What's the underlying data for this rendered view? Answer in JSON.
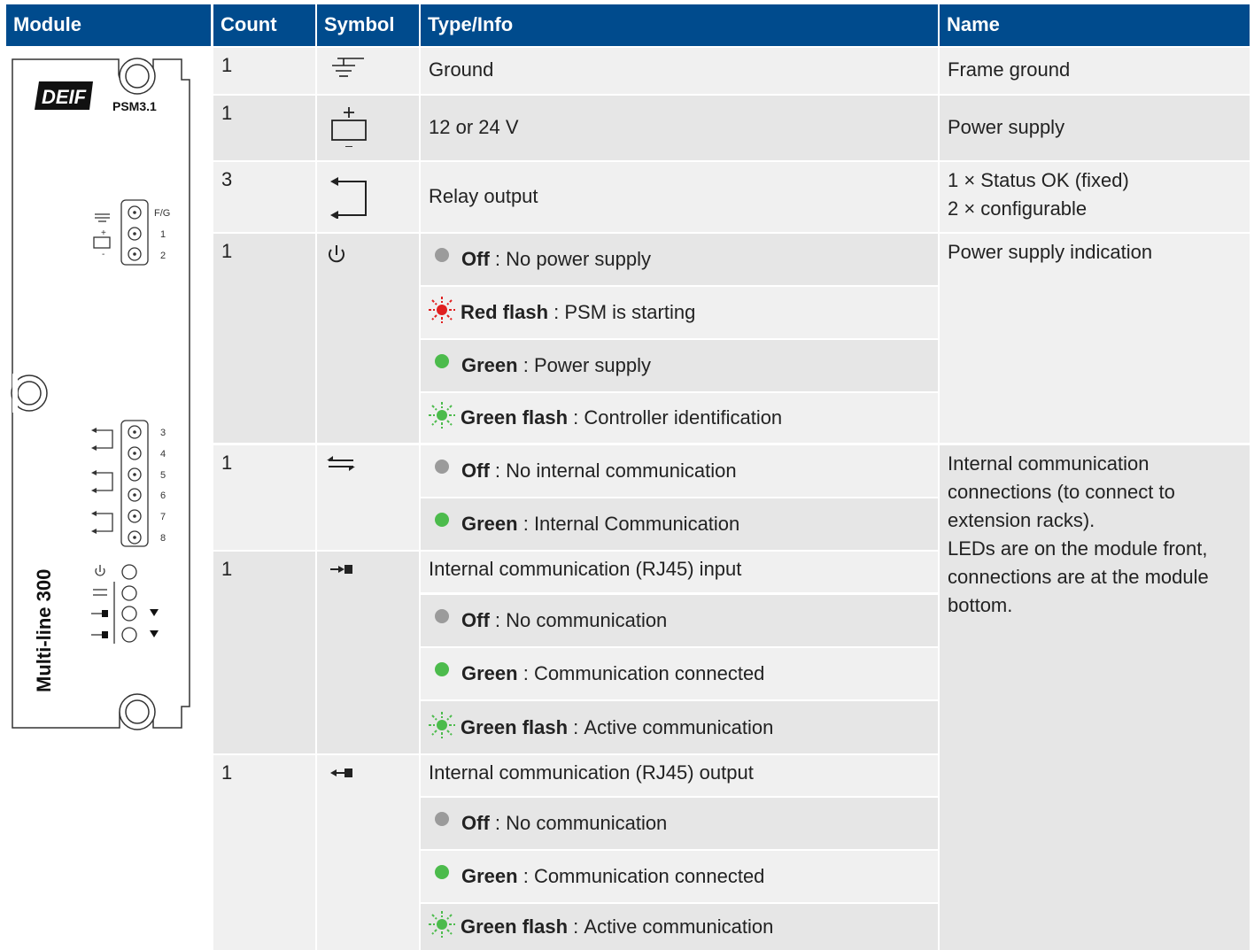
{
  "headers": {
    "module": "Module",
    "count": "Count",
    "symbol": "Symbol",
    "type_info": "Type/Info",
    "name": "Name"
  },
  "module_panel": {
    "brand": "DEIF",
    "model": "PSM3.1",
    "product": "Multi-line 300",
    "terminal_labels": [
      "F/G",
      "1",
      "2",
      "3",
      "4",
      "5",
      "6",
      "7",
      "8"
    ]
  },
  "rows": [
    {
      "count": "1",
      "symbol_icon": "ground-icon",
      "type": "Ground",
      "name": "Frame ground"
    },
    {
      "count": "1",
      "symbol_icon": "battery-icon",
      "type": "12 or 24 V",
      "name": "Power supply"
    },
    {
      "count": "3",
      "symbol_icon": "relay-icon",
      "type": "Relay output",
      "name_lines": [
        "1 × Status OK (fixed)",
        "2 × configurable"
      ]
    },
    {
      "count": "1",
      "symbol_icon": "power-icon",
      "name": "Power supply indication",
      "leds": [
        {
          "state": "Off",
          "desc": "No power supply",
          "indicator": "gray"
        },
        {
          "state": "Red flash",
          "desc": "PSM is starting",
          "indicator": "red-flash"
        },
        {
          "state": "Green",
          "desc": "Power supply",
          "indicator": "green"
        },
        {
          "state": "Green flash",
          "desc": "Controller identification",
          "indicator": "green-flash"
        }
      ]
    },
    {
      "count": "1",
      "symbol_icon": "internal-comm-icon",
      "name_lines": [
        "Internal communication",
        "connections (to connect to",
        "extension racks).",
        "LEDs are on the module front,",
        "connections are at the module",
        "bottom."
      ],
      "leds": [
        {
          "state": "Off",
          "desc": "No internal communication",
          "indicator": "gray"
        },
        {
          "state": "Green",
          "desc": "Internal Communication",
          "indicator": "green"
        }
      ]
    },
    {
      "count": "1",
      "symbol_icon": "rj45-input-icon",
      "type": "Internal communication (RJ45) input",
      "leds": [
        {
          "state": "Off",
          "desc": "No communication",
          "indicator": "gray"
        },
        {
          "state": "Green",
          "desc": "Communication connected",
          "indicator": "green"
        },
        {
          "state": "Green flash",
          "desc": "Active communication",
          "indicator": "green-flash"
        }
      ]
    },
    {
      "count": "1",
      "symbol_icon": "rj45-output-icon",
      "type": "Internal communication (RJ45) output",
      "leds": [
        {
          "state": "Off",
          "desc": "No communication",
          "indicator": "gray"
        },
        {
          "state": "Green",
          "desc": "Communication connected",
          "indicator": "green"
        },
        {
          "state": "Green flash",
          "desc": "Active communication",
          "indicator": "green-flash"
        }
      ]
    }
  ],
  "colors": {
    "header": "#004b8d",
    "row_light": "#f0f0f0",
    "row_dark": "#e6e6e6",
    "led_green": "#4cbb4c",
    "led_red": "#e02020",
    "led_gray": "#9b9b9b"
  }
}
